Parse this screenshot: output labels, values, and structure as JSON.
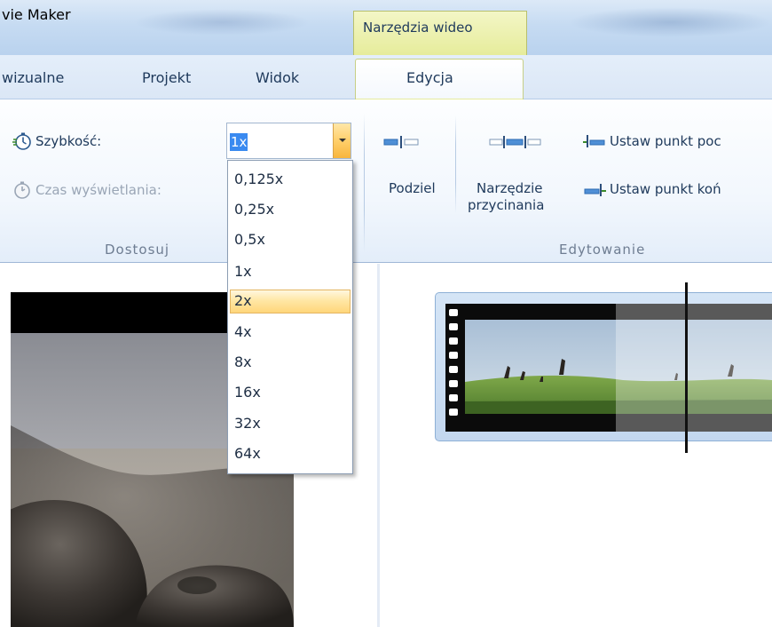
{
  "app": {
    "title": "vie Maker",
    "context_tab_group": "Narzędzia wideo"
  },
  "tabs": [
    {
      "id": "wizualne",
      "label": "wizualne"
    },
    {
      "id": "projekt",
      "label": "Projekt"
    },
    {
      "id": "widok",
      "label": "Widok"
    },
    {
      "id": "edycja",
      "label": "Edycja",
      "selected": true
    }
  ],
  "ribbon": {
    "adjust": {
      "label": "Dostosuj",
      "speed_label": "Szybkość:",
      "speed_value": "1x",
      "duration_label": "Czas wyświetlania:"
    },
    "edit": {
      "label": "Edytowanie",
      "split_label": "Podziel",
      "trim_label_1": "Narzędzie",
      "trim_label_2": "przycinania",
      "set_start_label": "Ustaw punkt poc",
      "set_end_label": "Ustaw punkt koń"
    }
  },
  "speed_dropdown": {
    "options": [
      "0,125x",
      "0,25x",
      "0,5x",
      "1x",
      "2x",
      "4x",
      "8x",
      "16x",
      "32x",
      "64x"
    ],
    "highlighted": "2x"
  },
  "colors": {
    "accent_text": "#1e395b",
    "context_tab": "#e6ec9b",
    "selection": "#3a8af0",
    "hover_item": "#ffd67a"
  }
}
